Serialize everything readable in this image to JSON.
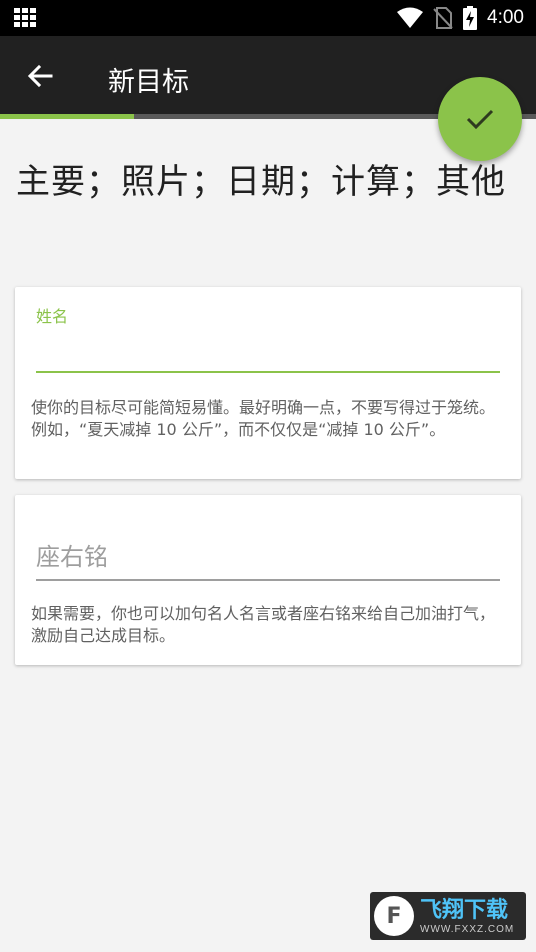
{
  "status_bar": {
    "time": "4:00"
  },
  "app_bar": {
    "title": "新目标",
    "progress_fraction": 0.25
  },
  "fab": {
    "icon": "check-icon",
    "color": "#8bc34a"
  },
  "section_heading": "主要；照片；日期；计算；其他",
  "name_card": {
    "label": "姓名",
    "value": "",
    "helper": "使你的目标尽可能简短易懂。最好明确一点，不要写得过于笼统。例如，“夏天减掉 10 公斤”，而不仅仅是“减掉 10 公斤”。"
  },
  "motto_card": {
    "placeholder": "座右铭",
    "value": "",
    "helper": "如果需要，你也可以加句名人名言或者座右铭来给自己加油打气，激励自己达成目标。"
  },
  "watermark": {
    "title": "飞翔下载",
    "url": "WWW.FXXZ.COM"
  },
  "colors": {
    "accent": "#8bc34a",
    "app_bar": "#212121",
    "background": "#f3f3f3"
  }
}
